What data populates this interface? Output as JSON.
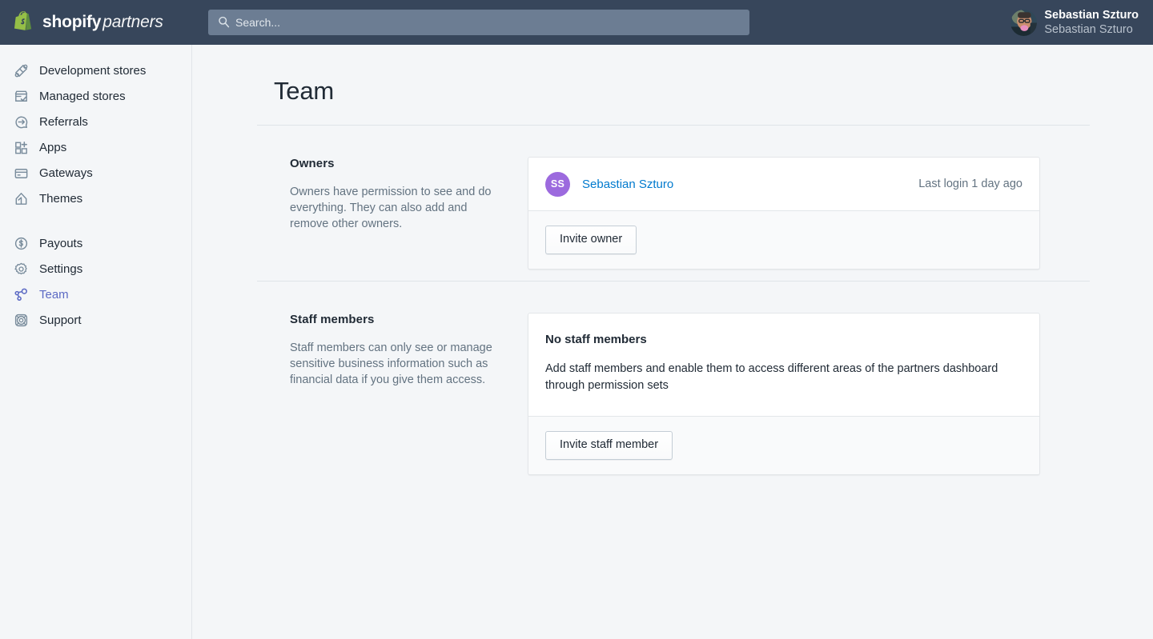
{
  "brand": {
    "name_bold": "shopify",
    "name_light": "partners",
    "logo_icon": "shopify-bag-icon",
    "logo_color": "#95BF47"
  },
  "search": {
    "placeholder": "Search...",
    "value": "",
    "icon": "search-icon"
  },
  "user": {
    "name": "Sebastian Szturo",
    "subtitle": "Sebastian Szturo",
    "avatar": "user-photo-avatar"
  },
  "sidebar": {
    "items": [
      {
        "label": "Development stores",
        "icon": "development-stores-icon",
        "active": false
      },
      {
        "label": "Managed stores",
        "icon": "managed-stores-icon",
        "active": false
      },
      {
        "label": "Referrals",
        "icon": "referrals-icon",
        "active": false
      },
      {
        "label": "Apps",
        "icon": "apps-icon",
        "active": false
      },
      {
        "label": "Gateways",
        "icon": "gateways-icon",
        "active": false
      },
      {
        "label": "Themes",
        "icon": "themes-icon",
        "active": false
      },
      {
        "label": "Payouts",
        "icon": "payouts-icon",
        "active": false
      },
      {
        "label": "Settings",
        "icon": "settings-gear-icon",
        "active": false
      },
      {
        "label": "Team",
        "icon": "team-nodes-icon",
        "active": true
      },
      {
        "label": "Support",
        "icon": "support-lifebuoy-icon",
        "active": false
      }
    ],
    "active_color": "#5C6AC4"
  },
  "page": {
    "title": "Team"
  },
  "owners": {
    "heading": "Owners",
    "description": "Owners have permission to see and do everything. They can also add and remove other owners.",
    "members": [
      {
        "initials": "SS",
        "name": "Sebastian Szturo",
        "last_login": "Last login 1 day ago",
        "avatar_color": "#9C6ADE"
      }
    ],
    "invite_button": "Invite owner"
  },
  "staff": {
    "heading": "Staff members",
    "description": "Staff members can only see or manage sensitive business information such as financial data if you give them access.",
    "empty_title": "No staff members",
    "empty_text": "Add staff members and enable them to access different areas of the partners dashboard through permission sets",
    "invite_button": "Invite staff member"
  }
}
